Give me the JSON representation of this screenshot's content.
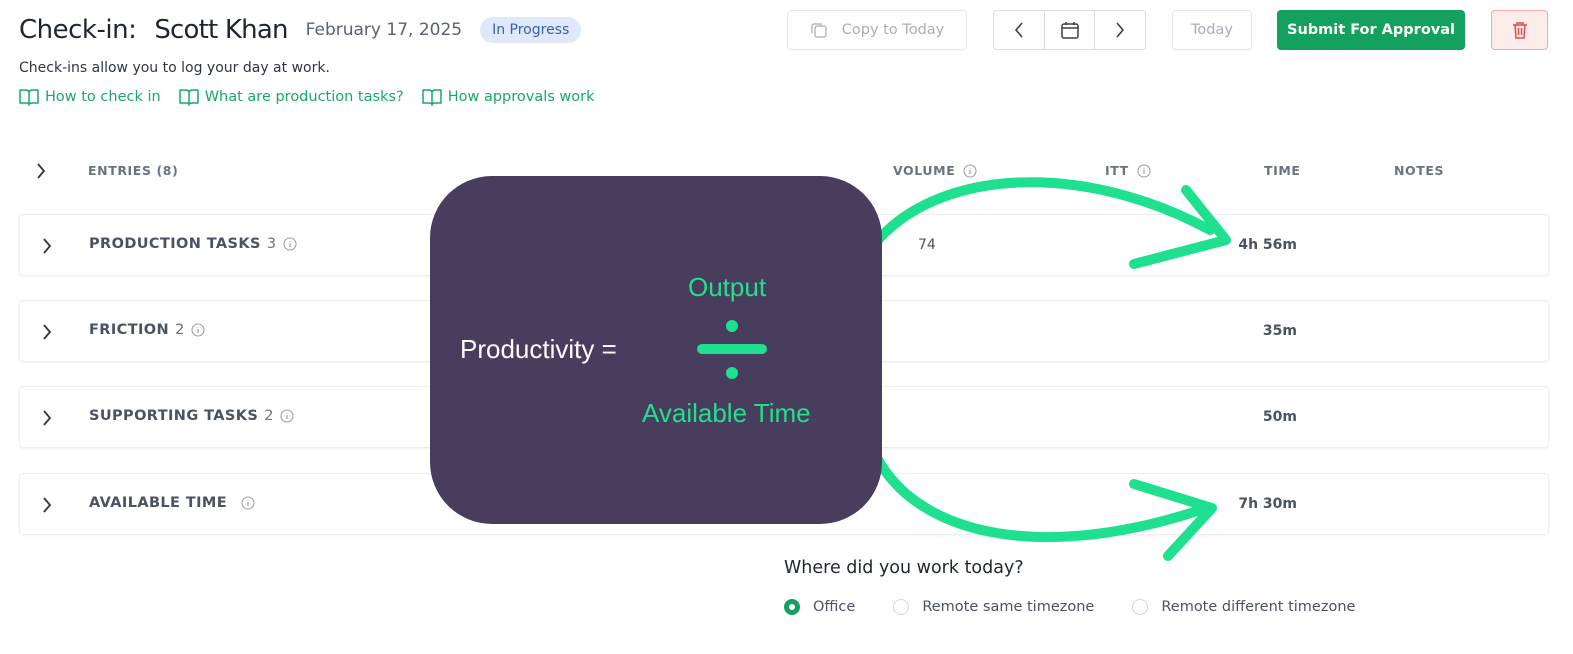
{
  "header": {
    "title_label": "Check-in:",
    "employee_name": "Scott Khan",
    "date": "February 17, 2025",
    "status": "In Progress"
  },
  "subtitle": "Check-ins allow you to log your day at work.",
  "help_links": [
    {
      "label": "How to check in",
      "icon": "book-open-icon"
    },
    {
      "label": "What are production tasks?",
      "icon": "book-open-icon"
    },
    {
      "label": "How approvals work",
      "icon": "book-open-icon"
    }
  ],
  "toolbar": {
    "copy_label": "Copy to Today",
    "today_label": "Today",
    "submit_label": "Submit For Approval"
  },
  "table": {
    "entries_label": "ENTRIES (8)",
    "columns": {
      "volume": "VOLUME",
      "itt": "ITT",
      "time": "TIME",
      "notes": "NOTES"
    },
    "rows": [
      {
        "label": "PRODUCTION TASKS",
        "count": "3",
        "volume": "74",
        "time": "4h 56m"
      },
      {
        "label": "FRICTION",
        "count": "2",
        "volume": "",
        "time": "35m"
      },
      {
        "label": "SUPPORTING TASKS",
        "count": "2",
        "volume": "",
        "time": "50m"
      },
      {
        "label": "AVAILABLE TIME",
        "count": "",
        "volume": "",
        "time": "7h 30m"
      }
    ]
  },
  "overlay": {
    "productivity": "Productivity =",
    "numerator": "Output",
    "denominator": "Available Time"
  },
  "work_location": {
    "question": "Where did you work today?",
    "options": [
      "Office",
      "Remote same timezone",
      "Remote different timezone"
    ],
    "selected": "Office"
  },
  "colors": {
    "accent_green": "#14a05f",
    "overlay_bg": "#493d5e",
    "overlay_highlight": "#1ee08f",
    "status_badge_bg": "#dfe9fb",
    "delete_bg": "#fdecec"
  }
}
